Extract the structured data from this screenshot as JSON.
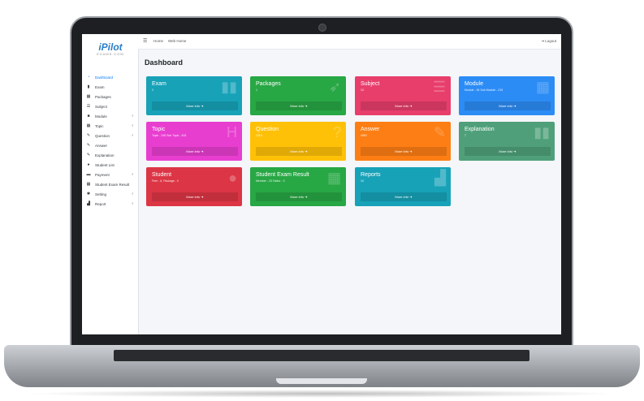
{
  "sidebar": {
    "logo": {
      "main": "iPilot",
      "sub": "EXAMS.COM"
    },
    "items": [
      {
        "label": "Dashboard",
        "icon": "gauge-icon",
        "glyph": "◔",
        "active": true,
        "caret": ""
      },
      {
        "label": "Exam",
        "icon": "book-icon",
        "glyph": "▮",
        "active": false,
        "caret": ""
      },
      {
        "label": "Packages",
        "icon": "grid-icon",
        "glyph": "▦",
        "active": false,
        "caret": ""
      },
      {
        "label": "Subject",
        "icon": "list-icon",
        "glyph": "☰",
        "active": false,
        "caret": ""
      },
      {
        "label": "Module",
        "icon": "module-icon",
        "glyph": "■",
        "active": false,
        "caret": "‹"
      },
      {
        "label": "Topic",
        "icon": "topic-icon",
        "glyph": "▦",
        "active": false,
        "caret": "‹"
      },
      {
        "label": "Question",
        "icon": "edit-icon",
        "glyph": "✎",
        "active": false,
        "caret": "‹"
      },
      {
        "label": "Answer",
        "icon": "edit-icon",
        "glyph": "✎",
        "active": false,
        "caret": ""
      },
      {
        "label": "Explanation",
        "icon": "edit-icon",
        "glyph": "✎",
        "active": false,
        "caret": ""
      },
      {
        "label": "Student List",
        "icon": "user-icon",
        "glyph": "●",
        "active": false,
        "caret": ""
      },
      {
        "label": "Payment",
        "icon": "card-icon",
        "glyph": "▬",
        "active": false,
        "caret": "‹"
      },
      {
        "label": "Student Exam Result",
        "icon": "table-icon",
        "glyph": "▦",
        "active": false,
        "caret": ""
      },
      {
        "label": "Setting",
        "icon": "gear-icon",
        "glyph": "✱",
        "active": false,
        "caret": "‹"
      },
      {
        "label": "Report",
        "icon": "chart-icon",
        "glyph": "▟",
        "active": false,
        "caret": "‹"
      }
    ]
  },
  "topbar": {
    "menu_glyph": "☰",
    "home": "Home",
    "web_home": "Web Home",
    "logout": "⇥ Logout"
  },
  "page_title": "Dashboard",
  "cards": [
    {
      "title": "Exam",
      "sub": "2",
      "foot": "More info ➜",
      "color": "#17a2b8",
      "icon": "book-icon",
      "glyph": "▮▮"
    },
    {
      "title": "Packages",
      "sub": "1",
      "foot": "More info ➜",
      "color": "#28a745",
      "icon": "rocket-icon",
      "glyph": "➶"
    },
    {
      "title": "Subject",
      "sub": "10",
      "foot": "More info ➜",
      "color": "#e83e6c",
      "icon": "list-icon",
      "glyph": "☰"
    },
    {
      "title": "Module",
      "sub": "Module - 94 Sub Module - 219",
      "foot": "More info ➜",
      "color": "#2c8cf5",
      "icon": "table-icon",
      "glyph": "▦"
    },
    {
      "title": "Topic",
      "sub": "Topic - 245 Sub Topic - 402",
      "foot": "More info ➜",
      "color": "#e83ed0",
      "icon": "hospital-icon",
      "glyph": "H"
    },
    {
      "title": "Question",
      "sub": "1213",
      "foot": "More info ➜",
      "color": "#ffc107",
      "icon": "question-icon",
      "glyph": "?"
    },
    {
      "title": "Answer",
      "sub": "4852",
      "foot": "More info ➜",
      "color": "#fd7e14",
      "icon": "edit-icon",
      "glyph": "✎"
    },
    {
      "title": "Explanation",
      "sub": "7",
      "foot": "More info ➜",
      "color": "#4fa07a",
      "icon": "book-open-icon",
      "glyph": "▮▮"
    },
    {
      "title": "Student",
      "sub": "Free - 6, Package - 0",
      "foot": "More info ➜",
      "color": "#dc3545",
      "icon": "user-icon",
      "glyph": "●"
    },
    {
      "title": "Student Exam Result",
      "sub": "Member - 23 Visitor - 0",
      "foot": "More info ➜",
      "color": "#28a745",
      "icon": "table-icon",
      "glyph": "▦"
    },
    {
      "title": "Reports",
      "sub": "10",
      "foot": "More info ➜",
      "color": "#17a2b8",
      "icon": "chart-icon",
      "glyph": "▟"
    }
  ]
}
